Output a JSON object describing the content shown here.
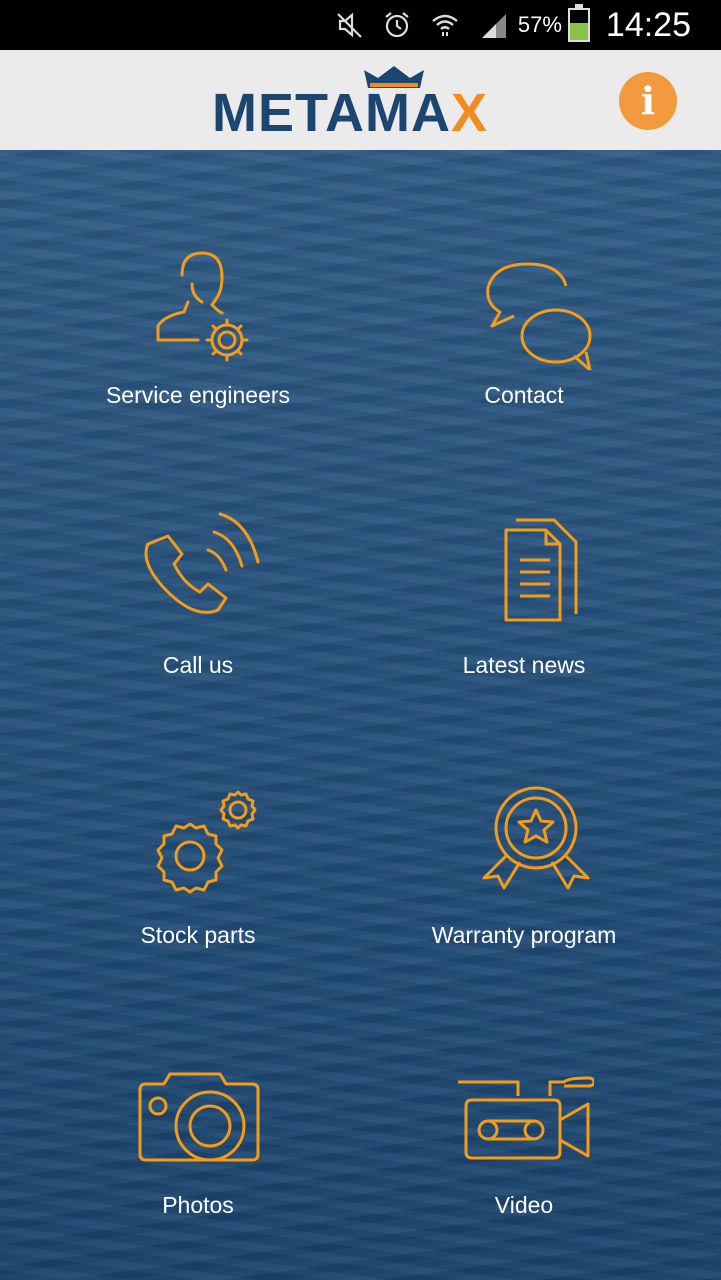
{
  "status_bar": {
    "battery_percent": "57%",
    "time": "14:25",
    "icons": [
      "mute-icon",
      "alarm-icon",
      "wifi-icon",
      "signal-icon",
      "battery-icon"
    ]
  },
  "header": {
    "logo_main": "METAMA",
    "logo_accent": "X",
    "info_label": "i"
  },
  "colors": {
    "accent": "#f39a3e",
    "icon_orange": "#f39c1a",
    "brand_navy": "#1c4670"
  },
  "menu": {
    "items": [
      {
        "label": "Service engineers",
        "icon": "engineer-gear-icon"
      },
      {
        "label": "Contact",
        "icon": "chat-bubbles-icon"
      },
      {
        "label": "Call us",
        "icon": "phone-icon"
      },
      {
        "label": "Latest news",
        "icon": "document-icon"
      },
      {
        "label": "Stock parts",
        "icon": "gears-icon"
      },
      {
        "label": "Warranty program",
        "icon": "award-badge-icon"
      },
      {
        "label": "Photos",
        "icon": "camera-icon"
      },
      {
        "label": "Video",
        "icon": "video-camera-icon"
      }
    ]
  }
}
